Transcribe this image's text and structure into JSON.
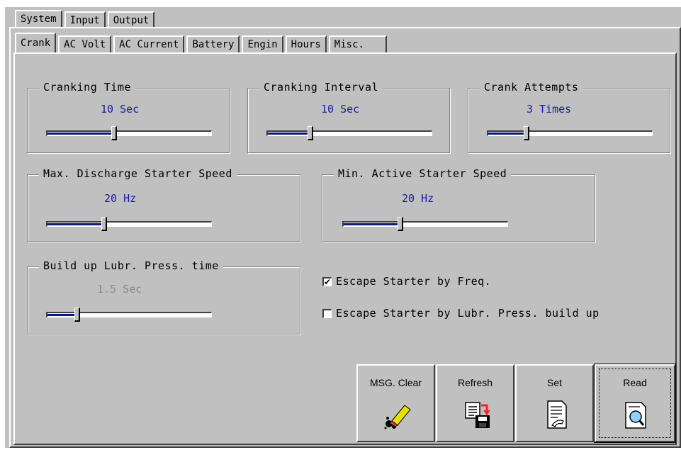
{
  "outer_tabs": [
    "System",
    "Input",
    "Output"
  ],
  "inner_tabs": [
    "Crank",
    "AC Volt",
    "AC Current",
    "Battery",
    "Engin",
    "Hours",
    "Misc."
  ],
  "groups": {
    "cranking_time": {
      "title": "Cranking Time",
      "value": "10 Sec",
      "level": 0.41
    },
    "cranking_interval": {
      "title": "Cranking Interval",
      "value": "10 Sec",
      "level": 0.26
    },
    "crank_attempts": {
      "title": "Crank Attempts",
      "value": "3 Times",
      "level": 0.23
    },
    "max_discharge": {
      "title": "Max. Discharge Starter Speed",
      "value": "20 Hz",
      "level": 0.35
    },
    "min_active": {
      "title": "Min. Active Starter Speed",
      "value": "20 Hz",
      "level": 0.35
    },
    "build_up": {
      "title": "Build up Lubr. Press. time",
      "value": "1.5 Sec",
      "level": 0.18,
      "disabled": true
    }
  },
  "checks": {
    "escape_freq": {
      "label": "Escape Starter by Freq.",
      "checked": true,
      "mark": "✔"
    },
    "escape_lubr": {
      "label": "Escape Starter by Lubr. Press. build up",
      "checked": false,
      "mark": ""
    }
  },
  "buttons": {
    "msg_clear": "MSG. Clear",
    "refresh": "Refresh",
    "set": "Set",
    "read": "Read"
  },
  "icons": [
    "eraser-icon",
    "refresh-floppy-icon",
    "document-pen-icon",
    "document-magnifier-icon"
  ],
  "colors": {
    "value_text": "#1a1aa8",
    "slider_fill": "#0a1a7a",
    "face": "#c0c0c0"
  }
}
